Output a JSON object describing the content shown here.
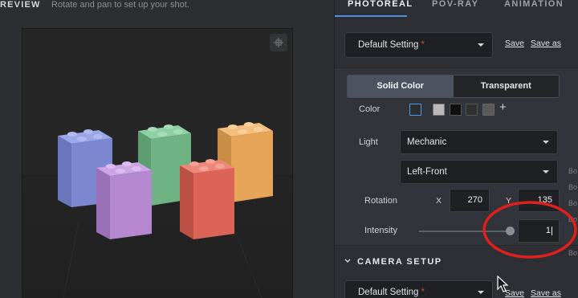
{
  "preview": {
    "title": "REVIEW",
    "hint": "Rotate and pan to set up your shot."
  },
  "tabs": [
    {
      "label": "PHOTOREAL",
      "active": true
    },
    {
      "label": "POV-RAY",
      "active": false
    },
    {
      "label": "ANIMATION",
      "active": false
    }
  ],
  "preset": {
    "value": "Default Setting",
    "required_mark": "*",
    "save_label": "Save",
    "save_as_label": "Save as"
  },
  "background": {
    "options": [
      "Solid Color",
      "Transparent"
    ],
    "selected": "Solid Color",
    "color_label": "Color",
    "swatches": [
      "#2b2d31",
      "#b9b9b9",
      "#101010",
      "#303030",
      "#5a5a5a"
    ],
    "add_icon": "+"
  },
  "light": {
    "label": "Light",
    "type": "Mechanic",
    "direction": "Left-Front",
    "rotation_label": "Rotation",
    "x_label": "X",
    "x_value": "270",
    "y_label": "Y",
    "y_value": "135",
    "intensity_label": "Intensity",
    "intensity_value": "1",
    "intensity_level": 1.0
  },
  "camera": {
    "title": "CAMERA SETUP",
    "preset_value": "Default Setting",
    "required_mark": "*",
    "save_label": "Save",
    "save_as_label": "Save as"
  },
  "edge_text": [
    "Bo",
    "Bo",
    "Bo",
    "Bo",
    "Bo"
  ],
  "colors": {
    "accent": "#4f8de0",
    "annotation": "#e0201c",
    "brick_blue": "#7b88d0",
    "brick_green": "#6fb384",
    "brick_orange": "#e5a457",
    "brick_purple": "#b487cf",
    "brick_red": "#dc6457"
  }
}
